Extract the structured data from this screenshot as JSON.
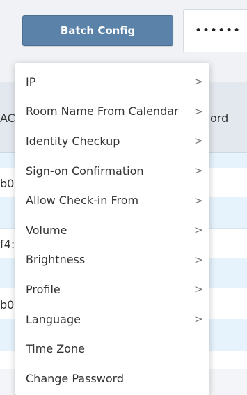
{
  "toolbar": {
    "batch_config_label": "Batch Config",
    "password_value": "••••••"
  },
  "table": {
    "header_left_fragment": "AC",
    "header_right_fragment": "ord",
    "row_fragments": [
      "b0",
      "f4:",
      "b0"
    ]
  },
  "menu": {
    "items": [
      {
        "label": "IP",
        "arrow": ">"
      },
      {
        "label": "Room Name From Calendar",
        "arrow": ">"
      },
      {
        "label": "Identity Checkup",
        "arrow": ">"
      },
      {
        "label": "Sign-on Confirmation",
        "arrow": ">"
      },
      {
        "label": "Allow Check-in From",
        "arrow": ">"
      },
      {
        "label": "Volume",
        "arrow": ">"
      },
      {
        "label": "Brightness",
        "arrow": ">"
      },
      {
        "label": "Profile",
        "arrow": ">"
      },
      {
        "label": "Language",
        "arrow": ">"
      },
      {
        "label": "Time Zone",
        "arrow": ""
      },
      {
        "label": "Change Password",
        "arrow": ""
      }
    ]
  },
  "colors": {
    "button_bg": "#5b82a8",
    "row_highlight": "#e6f3fc",
    "header_bg": "#e3e8ee"
  }
}
